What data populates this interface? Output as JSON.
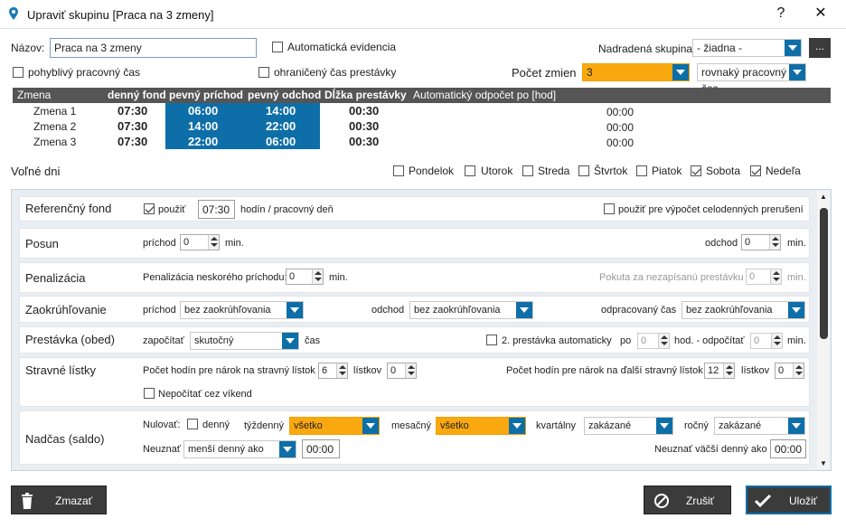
{
  "window": {
    "title": "Upraviť skupinu [Praca na 3 zmeny]",
    "help": "?",
    "close": "✕"
  },
  "form": {
    "name_label": "Názov:",
    "name_value": "Praca na 3 zmeny",
    "auto_evidence": "Automatická evidencia",
    "parent_label": "Nadradená skupina:",
    "parent_value": "- žiadna -",
    "browse": "...",
    "flexible": "pohyblivý pracovný čas",
    "limited_break": "ohraničený čas prestávky",
    "shift_count_label": "Počet zmien",
    "shift_count_value": "3",
    "shift_mode": "rovnaký pracovný čas"
  },
  "grid": {
    "headers": [
      "Zmena",
      "denný fond",
      "pevný príchod",
      "pevný odchod",
      "Dĺžka prestávky",
      "Automatický odpočet po [hod]"
    ],
    "rows": [
      {
        "name": "Zmena 1",
        "fund": "07:30",
        "arrival": "06:00",
        "departure": "14:00",
        "break": "00:30",
        "auto": "00:00"
      },
      {
        "name": "Zmena 2",
        "fund": "07:30",
        "arrival": "14:00",
        "departure": "22:00",
        "break": "00:30",
        "auto": "00:00"
      },
      {
        "name": "Zmena 3",
        "fund": "07:30",
        "arrival": "22:00",
        "departure": "06:00",
        "break": "00:30",
        "auto": "00:00"
      }
    ]
  },
  "free_days": {
    "label": "Voľné dni",
    "days": [
      {
        "name": "Pondelok",
        "checked": false
      },
      {
        "name": "Utorok",
        "checked": false
      },
      {
        "name": "Streda",
        "checked": false
      },
      {
        "name": "Štvrtok",
        "checked": false
      },
      {
        "name": "Piatok",
        "checked": false
      },
      {
        "name": "Sobota",
        "checked": true
      },
      {
        "name": "Nedeľa",
        "checked": true
      }
    ]
  },
  "sections": {
    "ref": {
      "title": "Referenčný fond",
      "use": "použiť",
      "value": "07:30",
      "unit": "hodín / pracovný deň",
      "full_day": "použiť pre výpočet celodenných prerušení"
    },
    "posun": {
      "title": "Posun",
      "arrival": "príchod",
      "arrival_val": "0",
      "min": "min.",
      "departure": "odchod",
      "departure_val": "0"
    },
    "pen": {
      "title": "Penalizácia",
      "late": "Penalizácia neskorého príchodu:",
      "late_val": "0",
      "min": "min.",
      "fine": "Pokuta za nezapísanú prestávku",
      "fine_val": "0"
    },
    "round": {
      "title": "Zaokrúhľovanie",
      "arrival": "príchod",
      "arrival_val": "bez zaokrúhľovania",
      "departure": "odchod",
      "departure_val": "bez zaokrúhľovania",
      "worked": "odpracovaný čas",
      "worked_val": "bez zaokrúhľovania"
    },
    "brk": {
      "title": "Prestávka (obed)",
      "count": "započítať",
      "count_val": "skutočný",
      "time": "čas",
      "second": "2. prestávka automaticky",
      "po": "po",
      "po_val": "0",
      "hod": "hod. - odpočítať",
      "hod_val": "0",
      "min": "min."
    },
    "meal": {
      "title": "Stravné lístky",
      "hours": "Počet hodín pre nárok na stravný lístok",
      "hours_val": "6",
      "tickets": "lístkov",
      "tickets_val": "0",
      "next": "Počet hodín pre nárok na ďalší stravný lístok",
      "next_val": "12",
      "next_tickets_val": "0",
      "weekend": "Nepočítať cez víkend"
    },
    "ot": {
      "title": "Nadčas (saldo)",
      "reset": "Nulovať:",
      "daily": "denný",
      "weekly": "týždenný",
      "weekly_val": "všetko",
      "monthly": "mesačný",
      "monthly_val": "všetko",
      "quarterly": "kvartálny",
      "quarterly_val": "zakázané",
      "yearly": "ročný",
      "yearly_val": "zakázané",
      "ignore": "Neuznať",
      "ignore_val": "menší denný ako",
      "ignore_time": "00:00",
      "ignore_more": "Neuznať väčší denný ako",
      "ignore_more_time": "00:00"
    }
  },
  "buttons": {
    "delete": "Zmazať",
    "cancel": "Zrušiť",
    "save": "Uložiť"
  }
}
